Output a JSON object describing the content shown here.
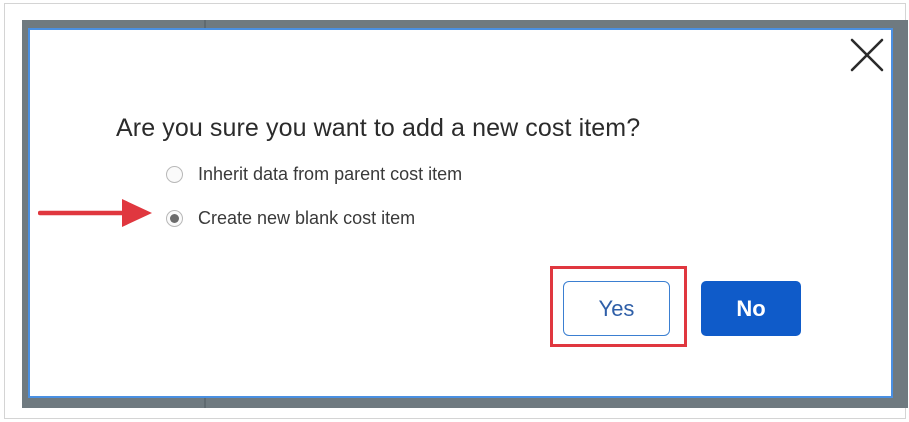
{
  "dialog": {
    "title": "Are you sure you want to add a new cost item?",
    "options": [
      {
        "label": "Inherit data from parent cost item",
        "checked": false
      },
      {
        "label": "Create new blank cost item",
        "checked": true
      }
    ],
    "buttons": {
      "yes_label": "Yes",
      "no_label": "No"
    },
    "close_icon": "close-icon"
  },
  "annotations": {
    "arrow_icon": "arrow-right-icon",
    "arrow_color": "#e0373f",
    "highlight_color": "#e0373f"
  },
  "colors": {
    "dialog_border": "#4a90e2",
    "primary_button": "#0f5bc9",
    "secondary_button_border": "#3b7fd1"
  }
}
